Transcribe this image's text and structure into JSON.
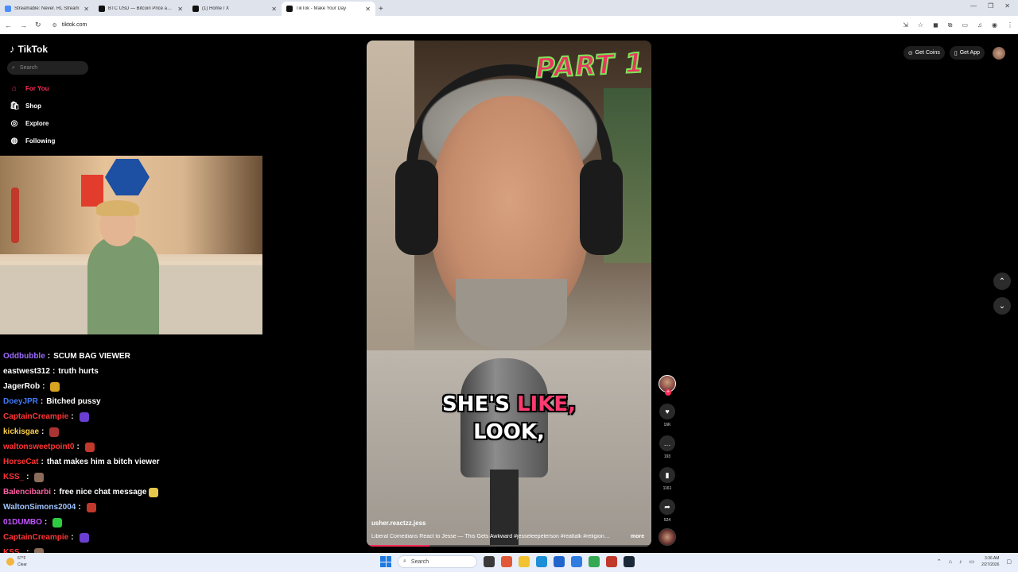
{
  "browser": {
    "tabs": [
      {
        "title": "Streamable: Never. RL Stream",
        "icon_color": "#4a8cff",
        "active": false
      },
      {
        "title": "BTC USD — Bitcoin Price and C",
        "icon_color": "#111111",
        "active": false
      },
      {
        "title": "(1) Home / X",
        "icon_color": "#111111",
        "active": false
      },
      {
        "title": "TikTok - Make Your Day",
        "icon_color": "#111111",
        "active": true
      }
    ],
    "new_tab": "+",
    "url": "tiktok.com"
  },
  "sidebar": {
    "logo": "TikTok",
    "search_placeholder": "Search",
    "items": [
      {
        "label": "For You",
        "icon": "home-icon",
        "active": true
      },
      {
        "label": "Shop",
        "icon": "shop-bag-icon",
        "active": false
      },
      {
        "label": "Explore",
        "icon": "compass-icon",
        "active": false
      },
      {
        "label": "Following",
        "icon": "following-avatar-icon",
        "active": false
      }
    ]
  },
  "chat": [
    {
      "user": "Oddbubble",
      "msg": "SCUM BAG VIEWER",
      "color": "#9d6bff",
      "emote": ""
    },
    {
      "user": "eastwest312",
      "msg": "truth hurts",
      "color": "#ffffff",
      "emote": ""
    },
    {
      "user": "JagerRob",
      "msg": "",
      "color": "#ffffff",
      "emote": "#d9a520"
    },
    {
      "user": "DoeyJPR",
      "msg": "Bitched pussy",
      "color": "#3e7bff",
      "emote": ""
    },
    {
      "user": "CaptainCreampie",
      "msg": "",
      "color": "#ff3434",
      "emote": "#6a3fd1"
    },
    {
      "user": "kickisgae",
      "msg": "",
      "color": "#ffd24a",
      "emote": "#a33"
    },
    {
      "user": "waltonsweetpoint0",
      "msg": "",
      "color": "#ff3434",
      "emote": "#c0392b"
    },
    {
      "user": "HorseCat",
      "msg": "that makes him a bitch viewer",
      "color": "#ff3434",
      "emote": ""
    },
    {
      "user": "KSS_",
      "msg": "",
      "color": "#ff3434",
      "emote": "#8b6b5a"
    },
    {
      "user": "Balencibarbi",
      "msg": "free nice chat message",
      "color": "#ff5fa2",
      "emote": "#e6c84a"
    },
    {
      "user": "WaltonSimons2004",
      "msg": "",
      "color": "#9fc4ff",
      "emote": "#c0392b"
    },
    {
      "user": "01DUMBO",
      "msg": "",
      "color": "#c552ff",
      "emote": "#2ecc40"
    },
    {
      "user": "CaptainCreampie",
      "msg": "",
      "color": "#ff3434",
      "emote": "#6a3fd1"
    },
    {
      "user": "KSS_",
      "msg": "",
      "color": "#ff3434",
      "emote": "#8b6b5a"
    }
  ],
  "video": {
    "part_label": "PART 1",
    "caption_line1_a": "SHE'S ",
    "caption_line1_b": "LIKE,",
    "caption_line2": "LOOK,",
    "author": "usher.reactzz.jess",
    "description": "Liberal Comedians React to Jesse — This Gets Awkward #jesseleepeterson #realtalk #religion ...",
    "more": "more",
    "progress": 0.22
  },
  "actions": {
    "likes": "16K",
    "comments": "193",
    "saves": "1161",
    "shares": "524"
  },
  "top_right": {
    "get_coins": "Get Coins",
    "get_app": "Get App"
  },
  "taskbar": {
    "weather_temp": "67°F",
    "weather_desc": "Clear",
    "search_placeholder": "Search",
    "time": "3:36 AM",
    "date": "2/27/2026"
  }
}
